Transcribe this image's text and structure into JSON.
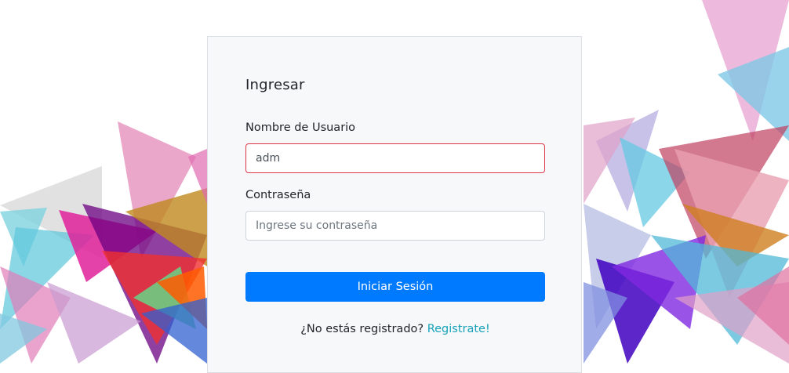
{
  "login": {
    "title": "Ingresar",
    "username_label": "Nombre de Usuario",
    "username_value": "adm",
    "password_label": "Contraseña",
    "password_placeholder": "Ingrese su contraseña",
    "submit_label": "Iniciar Sesión",
    "register_prompt": "¿No estás registrado?",
    "register_link": "Registrate!"
  },
  "colors": {
    "primary": "#007bff",
    "invalid": "#dc3545",
    "link": "#17a2b8"
  }
}
